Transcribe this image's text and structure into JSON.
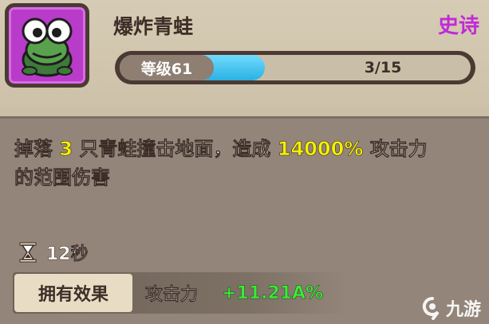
{
  "skill": {
    "name": "爆炸青蛙",
    "rarity": "史诗",
    "icon": "frog-icon",
    "level_label": "等级61",
    "progress_text": "3/15",
    "progress_fraction": 0.2
  },
  "description": {
    "part1": "掉落",
    "count": "3",
    "part2": "只青蛙撞击地面，造成",
    "damage": "14000%",
    "part3": "攻击力",
    "part4": "的范围伤害"
  },
  "cooldown": {
    "icon": "hourglass-icon",
    "value": "12秒"
  },
  "owned_effect": {
    "label": "拥有效果",
    "stat": "攻击力",
    "value": "+11.21A%"
  },
  "watermark": {
    "text": "九游",
    "icon": "jiuyou-logo-icon"
  },
  "colors": {
    "rarity": "#c02ad7",
    "highlight": "#f4f000",
    "bonus": "#3dea3a",
    "progress": "#2ab1e3"
  }
}
